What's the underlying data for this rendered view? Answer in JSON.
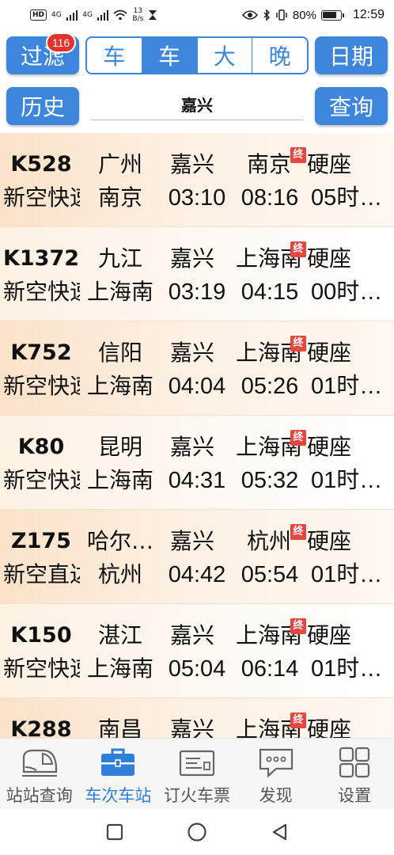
{
  "status_bar": {
    "hd": "HD",
    "net1": "4G",
    "net2": "4G",
    "speed_value": "13",
    "speed_unit": "B/s",
    "battery_pct": "80%",
    "battery_level": 0.8,
    "time": "12:59"
  },
  "toolbar": {
    "filter_label": "过滤",
    "filter_badge": "116",
    "date_label": "日期",
    "history_label": "历史",
    "query_label": "查询",
    "segments": [
      "车",
      "车",
      "大",
      "晚"
    ],
    "station": "嘉兴"
  },
  "trains": [
    {
      "no": "K528",
      "type": "新空快速",
      "from": "广州",
      "via": "嘉兴",
      "end": "南京",
      "seat": "硬座",
      "to": "南京",
      "dep": "03:10",
      "arr": "08:16",
      "dur": "05时…"
    },
    {
      "no": "K1372",
      "type": "新空快速",
      "from": "九江",
      "via": "嘉兴",
      "end": "上海南",
      "seat": "硬座",
      "to": "上海南",
      "dep": "03:19",
      "arr": "04:15",
      "dur": "00时…"
    },
    {
      "no": "K752",
      "type": "新空快速",
      "from": "信阳",
      "via": "嘉兴",
      "end": "上海南",
      "seat": "硬座",
      "to": "上海南",
      "dep": "04:04",
      "arr": "05:26",
      "dur": "01时…"
    },
    {
      "no": "K80",
      "type": "新空快速",
      "from": "昆明",
      "via": "嘉兴",
      "end": "上海南",
      "seat": "硬座",
      "to": "上海南",
      "dep": "04:31",
      "arr": "05:32",
      "dur": "01时…"
    },
    {
      "no": "Z175",
      "type": "新空直达",
      "from": "哈尔…",
      "via": "嘉兴",
      "end": "杭州",
      "seat": "硬座",
      "to": "杭州",
      "dep": "04:42",
      "arr": "05:54",
      "dur": "01时…"
    },
    {
      "no": "K150",
      "type": "新空快速",
      "from": "湛江",
      "via": "嘉兴",
      "end": "上海南",
      "seat": "硬座",
      "to": "上海南",
      "dep": "05:04",
      "arr": "06:14",
      "dur": "01时…"
    },
    {
      "no": "K288",
      "type": "",
      "from": "南昌",
      "via": "嘉兴",
      "end": "上海南",
      "seat": "硬座",
      "to": "",
      "dep": "",
      "arr": "",
      "dur": ""
    }
  ],
  "terminal_mark": "终",
  "bottom_nav": [
    {
      "label": "站站查询",
      "icon": "train-icon",
      "active": false
    },
    {
      "label": "车次车站",
      "icon": "briefcase-icon",
      "active": true
    },
    {
      "label": "订火车票",
      "icon": "ticket-icon",
      "active": false
    },
    {
      "label": "发现",
      "icon": "chat-bubble-icon",
      "active": false
    },
    {
      "label": "设置",
      "icon": "grid-icon",
      "active": false
    }
  ],
  "colors": {
    "accent": "#3d86dc",
    "badge": "#e4322b",
    "terminal_mark": "#e64540",
    "row_tint": "#fbe2c8"
  }
}
